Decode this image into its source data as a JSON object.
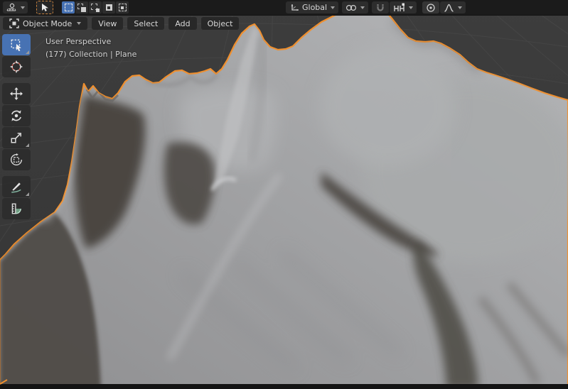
{
  "topbar": {
    "editor_selector": {
      "icon": "editor-type-icon"
    },
    "active_tool": {
      "icon": "cursor-arrow-icon"
    },
    "select_modes": {
      "items": [
        "set",
        "extend",
        "subtract",
        "invert",
        "intersect"
      ],
      "active": "set",
      "icons": [
        "select-set-icon",
        "select-extend-icon",
        "select-subtract-icon",
        "select-invert-icon",
        "select-intersect-icon"
      ]
    },
    "orientation_label": "Global",
    "orientation_icon": "transform-orientation-icon",
    "pivot_icon": "pivot-point-icon",
    "snap_toggle_icon": "magnet-icon",
    "snap_target_icon": "snap-increment-icon",
    "proportional_toggle_icon": "proportional-editing-icon",
    "falloff_icon": "smooth-falloff-icon"
  },
  "viewport_header": {
    "mode_label": "Object Mode",
    "mode_icon": "object-mode-icon",
    "menus": [
      "View",
      "Select",
      "Add",
      "Object"
    ]
  },
  "tool_shelf": {
    "tools": [
      "select-box",
      "cursor",
      "move",
      "rotate",
      "scale",
      "transform",
      "annotate",
      "measure"
    ],
    "active_tool": "select-box"
  },
  "viewport": {
    "overlay": {
      "line1": "User Perspective",
      "line2": "(177) Collection | Plane"
    }
  },
  "colors": {
    "selection_outline": "#ef8f2e",
    "active_blue": "#4772b3",
    "topbar_bg": "#1b1b1b",
    "button_bg": "#2d2d2d",
    "viewport_bg": "#3a3a3a",
    "mesh_light": "#b5b6b8",
    "mesh_dark": "#8e8e90"
  }
}
